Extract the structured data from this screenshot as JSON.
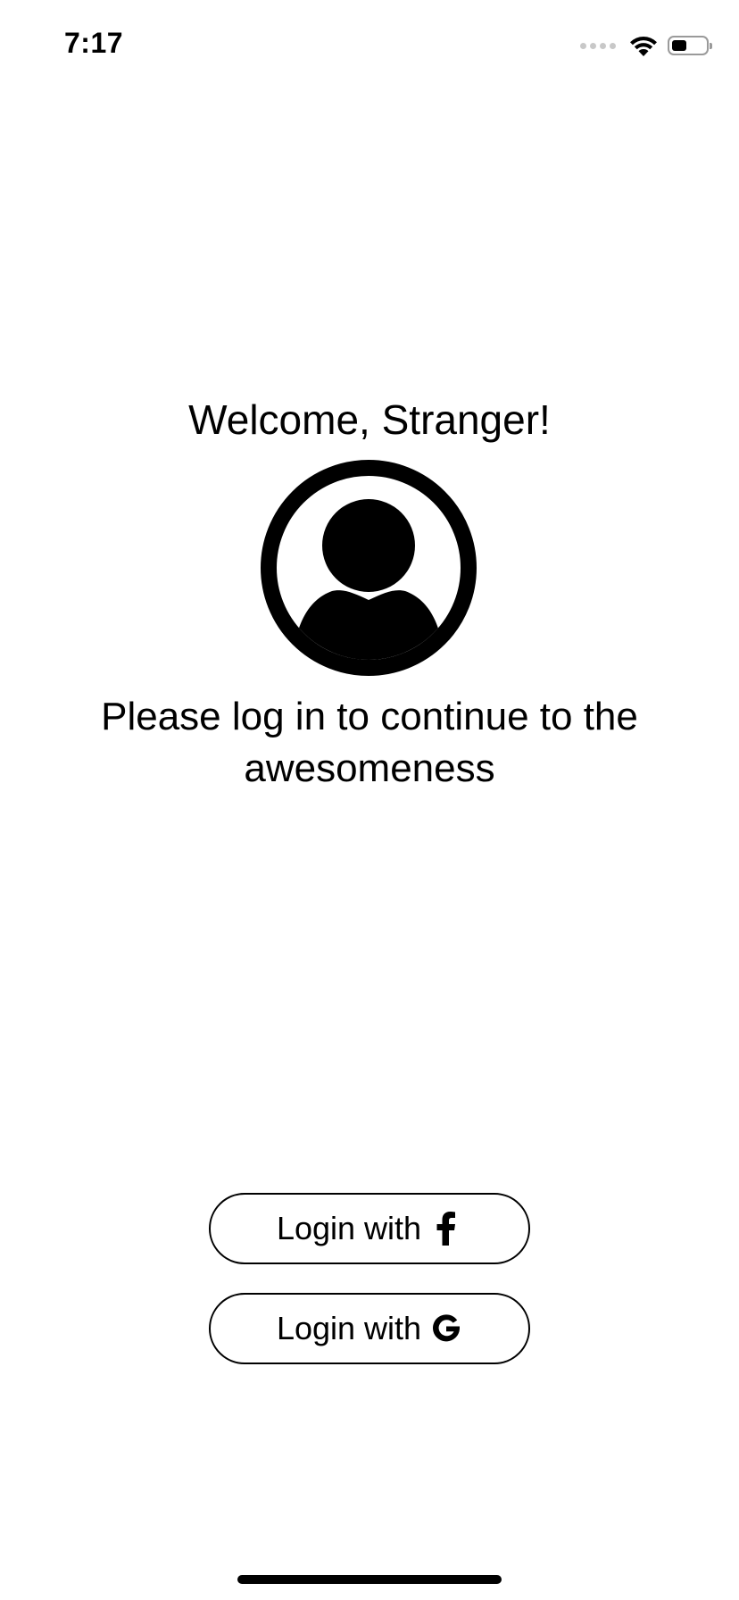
{
  "status_bar": {
    "time": "7:17",
    "signal_icon": "cellular-signal-icon",
    "wifi_icon": "wifi-icon",
    "battery_icon": "battery-icon",
    "battery_level": 0.45
  },
  "welcome": {
    "title": "Welcome, Stranger!",
    "avatar_icon": "user-avatar-icon",
    "subtitle": "Please log in to continue to the awesomeness"
  },
  "login": {
    "facebook_label": "Login with",
    "facebook_icon": "facebook-icon",
    "google_label": "Login with",
    "google_icon": "google-icon"
  },
  "colors": {
    "text": "#000000",
    "background": "#ffffff",
    "button_border": "#000000"
  }
}
